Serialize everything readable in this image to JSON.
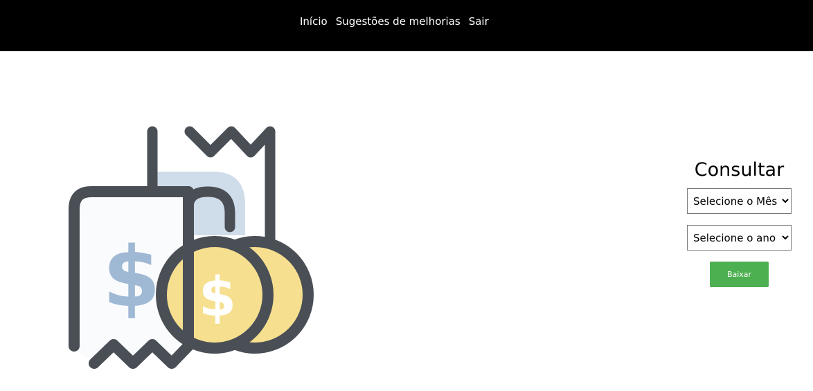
{
  "nav": {
    "items": [
      {
        "label": "Início"
      },
      {
        "label": "Sugestões de melhorias"
      },
      {
        "label": "Sair"
      }
    ]
  },
  "illustration": {
    "icon": "receipt-with-coins-icon",
    "colors": {
      "outline": "#4a4f56",
      "receipt_fill": "#fafbfc",
      "back_shade": "#cfdcea",
      "dollar_blue": "#9fb8d4",
      "coin_fill": "#f6e08f"
    }
  },
  "form": {
    "title": "Consultar",
    "month_select": {
      "selected": "Selecione o Mês"
    },
    "year_select": {
      "selected": "Selecione o ano"
    },
    "download_label": "Baixar",
    "button_color": "#4caf50"
  }
}
